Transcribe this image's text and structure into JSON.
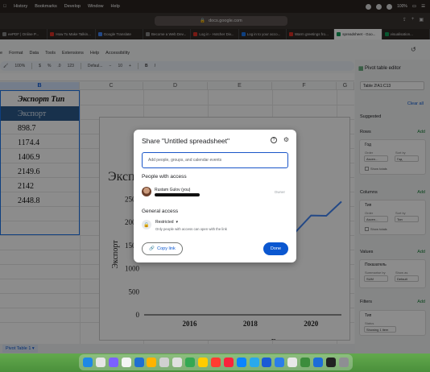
{
  "menubar": {
    "items": [
      "History",
      "Bookmarks",
      "Develop",
      "Window",
      "Help"
    ],
    "battery": "100%"
  },
  "browser": {
    "url": "docs.google.com",
    "tabs": [
      {
        "label": "eePDF | Online P..."
      },
      {
        "label": "How To Make Talkin..."
      },
      {
        "label": "Google Translate"
      },
      {
        "label": "Become a Web Dev..."
      },
      {
        "label": "Log in - Hotcher Div..."
      },
      {
        "label": "Log in to your acco..."
      },
      {
        "label": "Warm greetings fro..."
      },
      {
        "label": "spreadsheet - Goo...",
        "active": true
      },
      {
        "label": "visualisation..."
      }
    ]
  },
  "sheets": {
    "menu": [
      "e",
      "Format",
      "Data",
      "Tools",
      "Extensions",
      "Help",
      "Accessibility"
    ],
    "toolbar": {
      "zoom": "100%",
      "currency": "$",
      "percent": "%",
      "decimals": ".0",
      "format": "123",
      "font": "Defaul...",
      "size": "10",
      "bold": "B",
      "italic": "I"
    },
    "columns": [
      "B",
      "C",
      "D",
      "E",
      "F",
      "G"
    ],
    "cells_b": [
      {
        "text": "Экспорт Тип",
        "style": "hdr"
      },
      {
        "text": "Экспорт",
        "style": "blue"
      },
      {
        "text": "898.7"
      },
      {
        "text": "1174.4"
      },
      {
        "text": "1406.9"
      },
      {
        "text": "2149.6"
      },
      {
        "text": "2142"
      },
      {
        "text": "2448.8"
      }
    ],
    "sheet_tab": "Pivot Table 1 ▾"
  },
  "chart_data": {
    "type": "line",
    "title": "Экспо",
    "xlabel": "Год",
    "ylabel": "Экспорт",
    "x_ticks": [
      "2016",
      "2018",
      "2020"
    ],
    "y_ticks": [
      "0",
      "500",
      "1000",
      "1500",
      "2000",
      "2500"
    ],
    "xlim": [
      2014.5,
      2021
    ],
    "ylim": [
      0,
      2700
    ],
    "series": [
      {
        "x": [
          2019,
          2019.5,
          2020,
          2020.5,
          2021
        ],
        "values": [
          1406.9,
          1800,
          2149.6,
          2142,
          2448.8
        ]
      }
    ],
    "colors": {
      "line": "#4285f4"
    }
  },
  "pivot_panel": {
    "title": "Pivot table editor",
    "range": "Table 2!A1:C13",
    "clear_all": "Clear all",
    "suggested": "Suggested",
    "rows_label": "Rows",
    "rows_field": "Год",
    "order_label": "Order",
    "order_value": "Ascen...",
    "sortby_label": "Sort by",
    "sortby_value": "Год",
    "show_totals": "Show totals",
    "columns_label": "Columns",
    "columns_field": "Тип",
    "order2_value": "Ascen...",
    "sortby2_value": "Тип",
    "values_label": "Values",
    "values_field": "Показатель",
    "summarise_label": "Summarise by",
    "summarise_value": "SUM",
    "showas_label": "Show as",
    "showas_value": "Default",
    "filters_label": "Filters",
    "filter_field": "Тип",
    "status_label": "Status",
    "status_value": "Showing 1 item",
    "add": "Add"
  },
  "share_dialog": {
    "title": "Share \"Untitled spreadsheet\"",
    "input_placeholder": "Add people, groups, and calendar events",
    "people_heading": "People with access",
    "user_name": "Rustam Gulov (you)",
    "user_role": "Owner",
    "general_heading": "General access",
    "access_value": "Restricted",
    "access_desc": "Only people with access can open with the link",
    "copy_link": "Copy link",
    "done": "Done"
  },
  "dock": {
    "colors": [
      "#1e88e5",
      "#e6e6e6",
      "#7b61ff",
      "#f4f4f4",
      "#1f6fd1",
      "#ffb300",
      "#d0d0d0",
      "#e0e0e0",
      "#34a853",
      "#ffcc00",
      "#ff3b30",
      "#fa233b",
      "#0a84ff",
      "#29a9eb",
      "#1a5bd6",
      "#2b7de9",
      "#e8e8e8",
      "#3c8d3c",
      "#1d6dd8",
      "#222222",
      "#8e8e93"
    ]
  }
}
